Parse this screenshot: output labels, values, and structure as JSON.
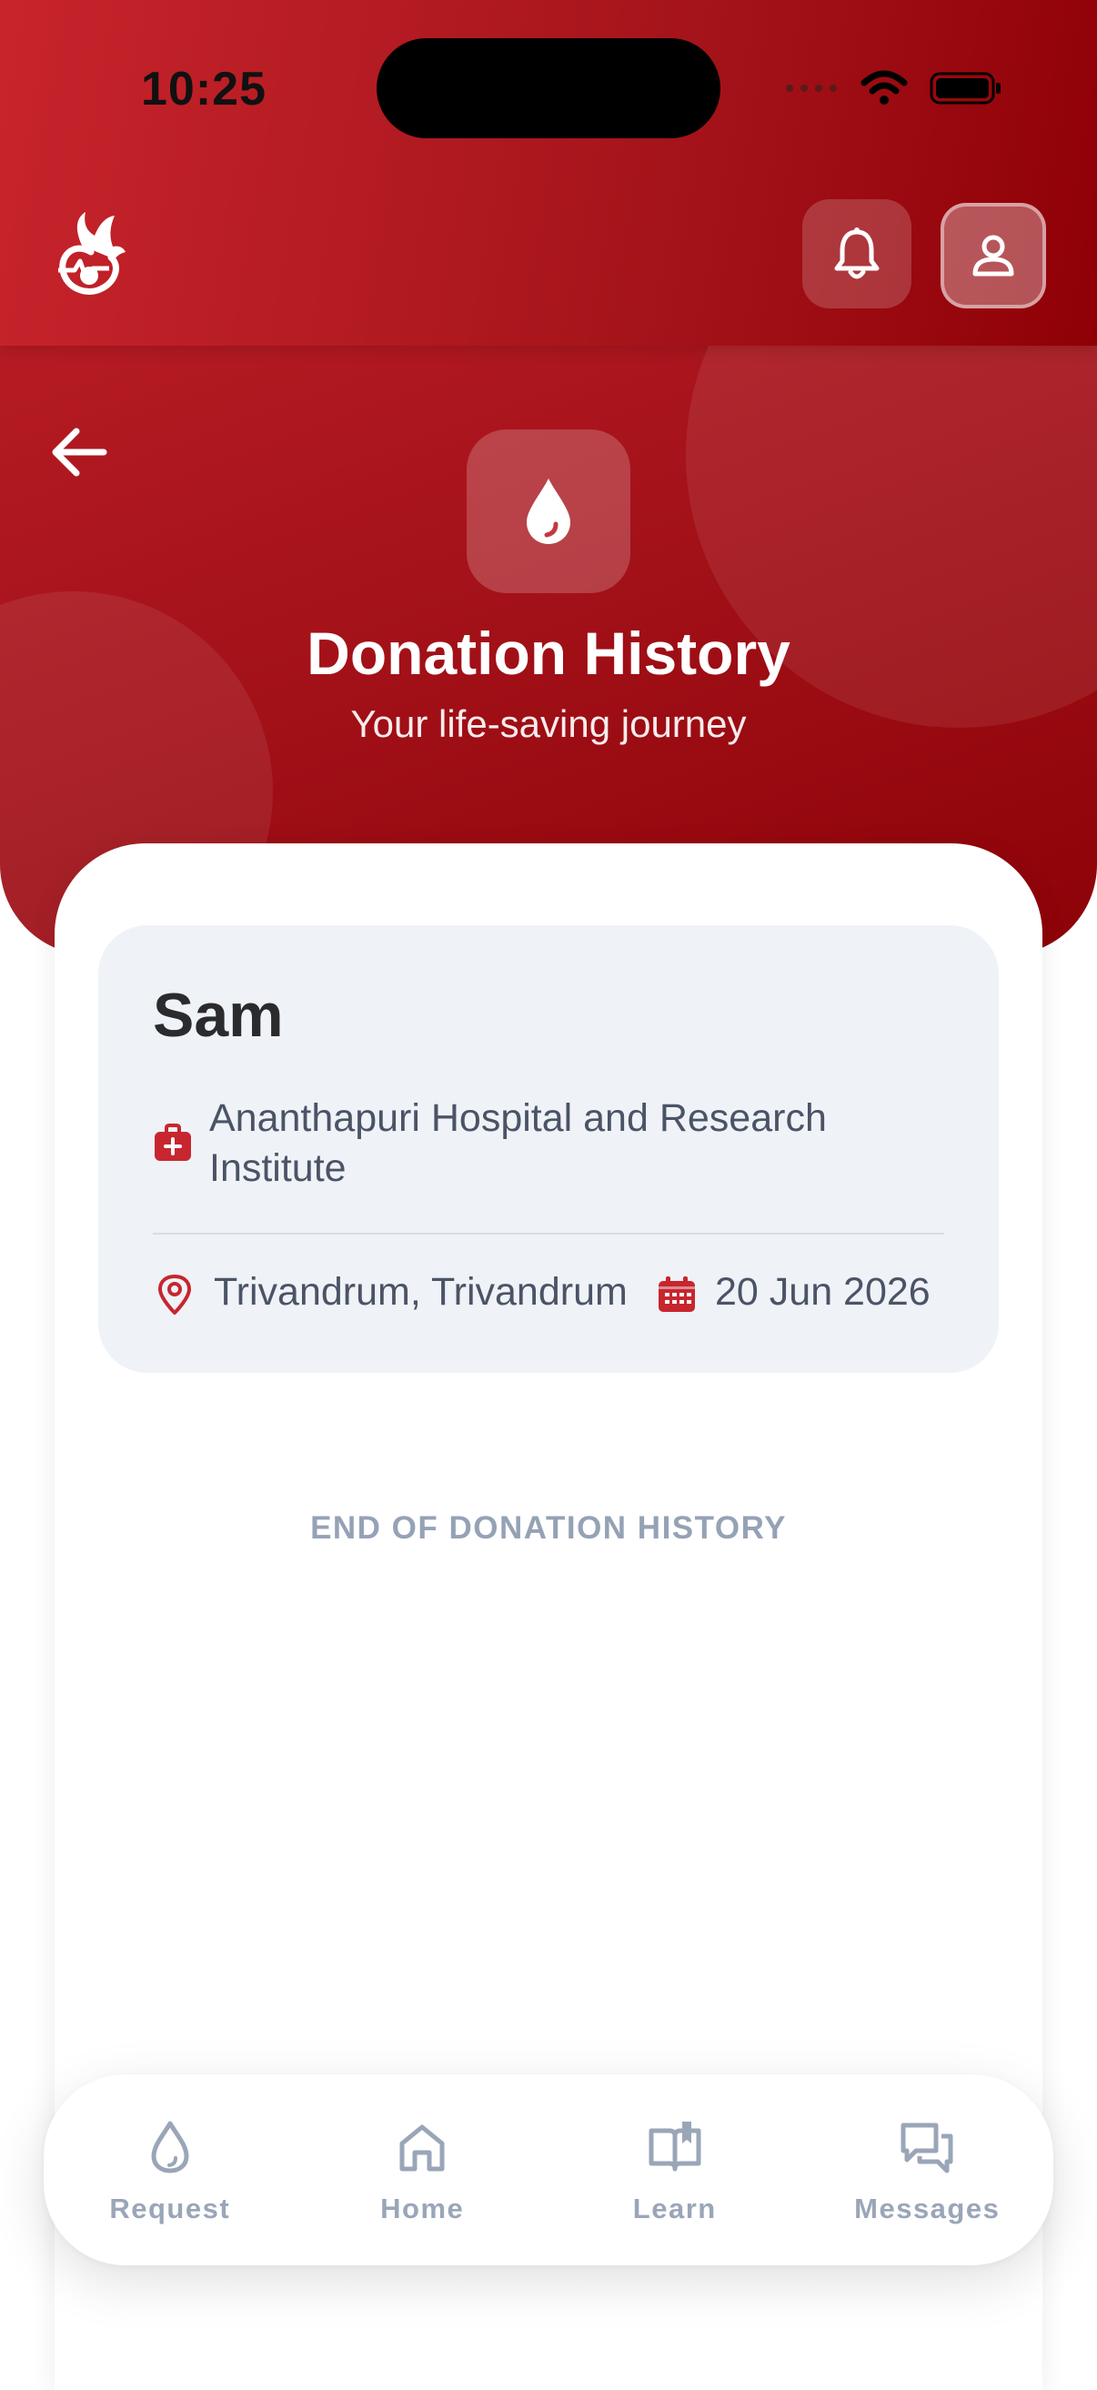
{
  "status_bar": {
    "time": "10:25"
  },
  "header": {
    "logo": "dove-heart-logo",
    "bell_icon": "bell-icon",
    "profile_icon": "user-icon"
  },
  "hero": {
    "back_icon": "arrow-left-icon",
    "drop_icon": "blood-drop-icon",
    "title": "Donation History",
    "subtitle": "Your life-saving journey"
  },
  "donation": {
    "donor_name": "Sam",
    "hospital": "Ananthapuri Hospital and Research Institute",
    "location": "Trivandrum, Trivandrum",
    "date": "20 Jun 2026"
  },
  "list_end": "END OF DONATION HISTORY",
  "bottom_nav": [
    {
      "label": "Request",
      "icon": "blood-drop-outline-icon"
    },
    {
      "label": "Home",
      "icon": "home-icon"
    },
    {
      "label": "Learn",
      "icon": "book-open-icon"
    },
    {
      "label": "Messages",
      "icon": "chat-bubbles-icon"
    }
  ],
  "colors": {
    "brand_red": "#b5161d",
    "dark_red": "#8c0207",
    "muted_text": "#4b5466",
    "nav_gray": "#9aa6b8",
    "card_bg": "#eff2f7"
  }
}
